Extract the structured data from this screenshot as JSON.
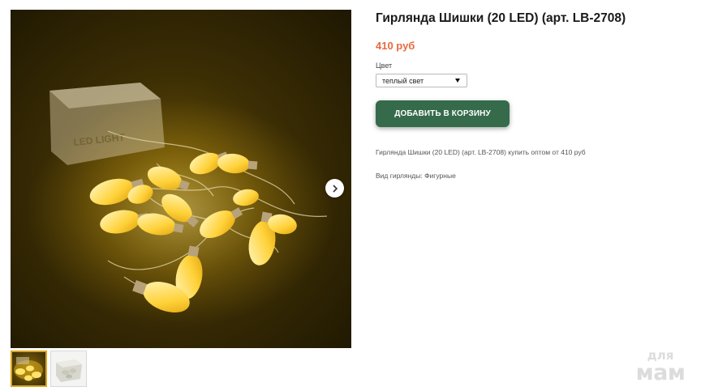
{
  "product": {
    "title": "Гирлянда Шишки (20 LED) (арт. LB-2708)",
    "price": "410 руб",
    "option_label": "Цвет",
    "option_selected": "теплый свет",
    "add_to_cart": "ДОБАВИТЬ В КОРЗИНУ",
    "description": "Гирлянда Шишки (20 LED) (арт. LB-2708) купить оптом от 410 руб",
    "attribute": "Вид гирлянды: Фигурные"
  },
  "gallery": {
    "box_text": "LED LIGHT",
    "thumbnails": [
      "thumb-warm-light",
      "thumb-packaging"
    ]
  },
  "icons": {
    "next": "chevron-right-icon",
    "select": "caret-down-icon"
  },
  "watermark": {
    "top": "для",
    "bottom": "мам"
  },
  "colors": {
    "price": "#e86a3d",
    "button": "#356b4b",
    "thumb_active_border": "#d9a520"
  }
}
